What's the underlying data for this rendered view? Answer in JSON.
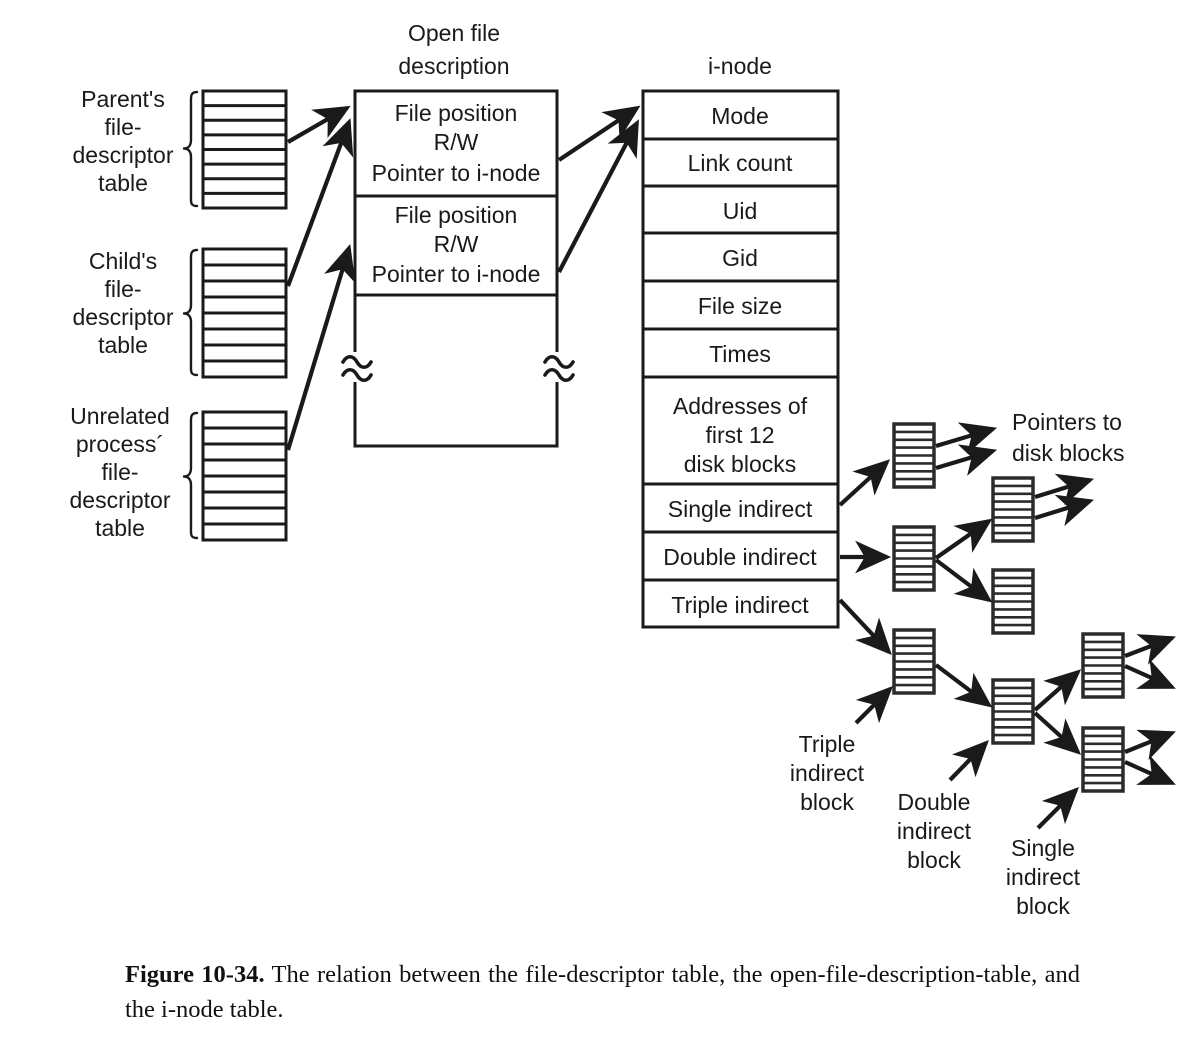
{
  "figure": {
    "label": "Figure 10-34.",
    "caption_text": " The relation between the file-descriptor table, the open-file-description-table, and the i-node table."
  },
  "headings": {
    "open_file_description": [
      "Open file",
      "description"
    ],
    "inode": "i-node",
    "pointers_to_disk_blocks": [
      "Pointers to",
      "disk blocks"
    ]
  },
  "fd_tables": [
    {
      "name": "parent",
      "label_lines": [
        "Parent's",
        "file-",
        "descriptor",
        "table"
      ],
      "rows": 8
    },
    {
      "name": "child",
      "label_lines": [
        "Child's",
        "file-",
        "descriptor",
        "table"
      ],
      "rows": 8
    },
    {
      "name": "unrelated",
      "label_lines": [
        "Unrelated",
        "process´",
        "file-",
        "descriptor",
        "table"
      ],
      "rows": 8
    }
  ],
  "open_file_description": {
    "entries": [
      {
        "lines": [
          "File position",
          "R/W",
          "Pointer to i-node"
        ]
      },
      {
        "lines": [
          "File position",
          "R/W",
          "Pointer to i-node"
        ]
      }
    ],
    "break_marker": "≈"
  },
  "inode": {
    "fields": [
      {
        "label": "Mode"
      },
      {
        "label": "Link count"
      },
      {
        "label": "Uid"
      },
      {
        "label": "Gid"
      },
      {
        "label": "File size"
      },
      {
        "label": "Times"
      },
      {
        "label": "Addresses of\nfirst 12\ndisk blocks",
        "lines": [
          "Addresses of",
          "first 12",
          "disk blocks"
        ]
      },
      {
        "label": "Single indirect"
      },
      {
        "label": "Double indirect"
      },
      {
        "label": "Triple indirect"
      }
    ]
  },
  "block_labels": {
    "triple": [
      "Triple",
      "indirect",
      "block"
    ],
    "double": [
      "Double",
      "indirect",
      "block"
    ],
    "single": [
      "Single",
      "indirect",
      "block"
    ]
  },
  "colors": {
    "ink": "#1a1a1a",
    "block_ink": "#2b2b2b",
    "background": "#ffffff"
  }
}
